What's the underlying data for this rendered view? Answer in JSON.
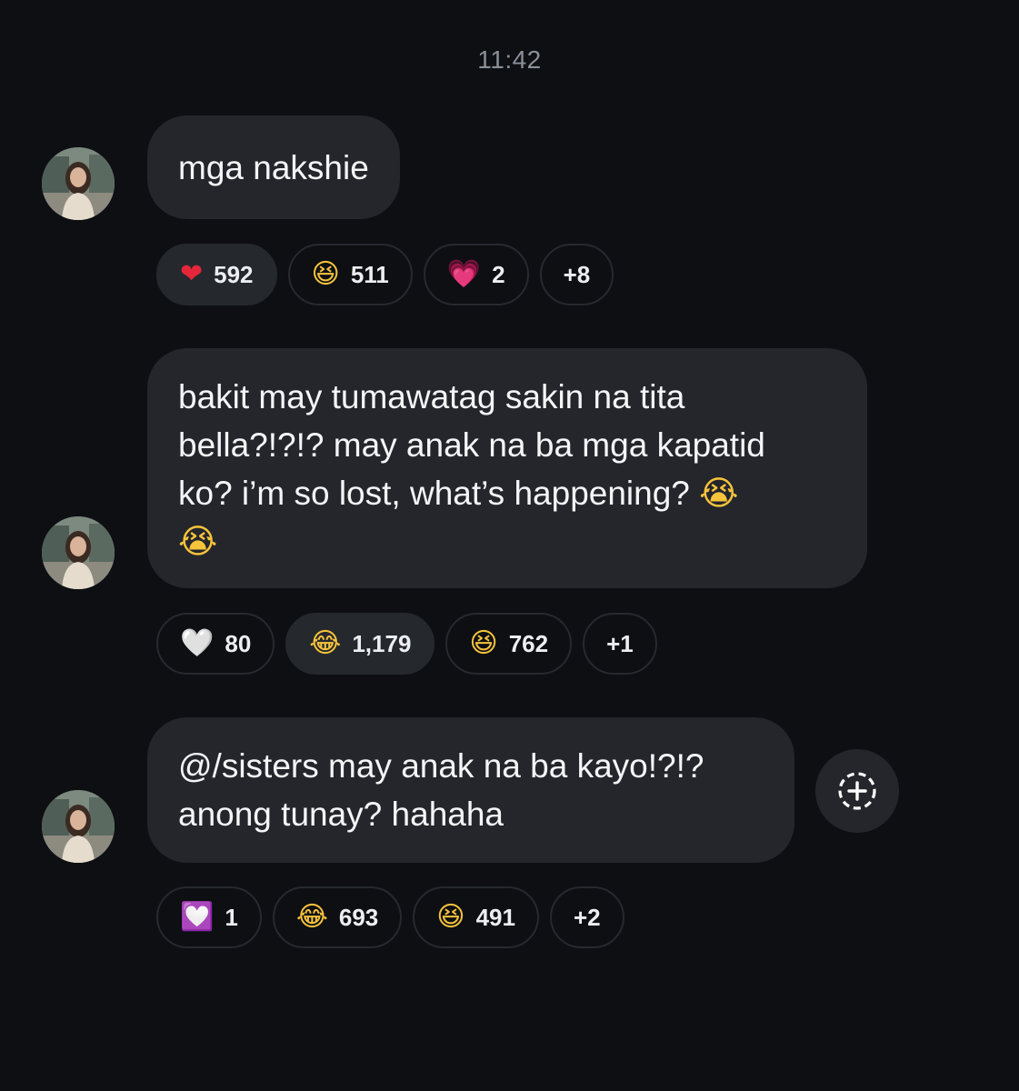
{
  "header": {
    "timestamp": "11:42"
  },
  "messages": [
    {
      "text": "mga nakshie",
      "reactions": [
        {
          "emoji": "❤",
          "icon": "red-heart-icon",
          "count": "592",
          "active": true
        },
        {
          "emoji": "😆",
          "icon": "grinning-squinting-face-icon",
          "count": "511",
          "active": false
        },
        {
          "emoji": "💗",
          "icon": "growing-heart-icon",
          "count": "2",
          "active": false
        },
        {
          "label": "+8",
          "active": false
        }
      ]
    },
    {
      "text": "bakit may tumawatag sakin na tita\nbella?!?!? may anak na ba mga kapatid\nko? i’m so lost, what’s happening? ",
      "emoji_end": "😭",
      "emoji_tail": "😭",
      "emoji_icon": "loudly-crying-face-icon",
      "reactions": [
        {
          "emoji": "🤍",
          "icon": "white-heart-icon",
          "count": "80",
          "active": false
        },
        {
          "emoji": "😂",
          "icon": "tears-of-joy-icon",
          "count": "1,179",
          "active": true
        },
        {
          "emoji": "😆",
          "icon": "grinning-squinting-face-icon",
          "count": "762",
          "active": false
        },
        {
          "label": "+1",
          "active": false
        }
      ]
    },
    {
      "text": "@/sisters may anak na ba kayo!?!?\nanong tunay? hahaha",
      "reactions": [
        {
          "emoji": "💟",
          "icon": "heart-decoration-icon",
          "count": "1",
          "active": false
        },
        {
          "emoji": "😂",
          "icon": "tears-of-joy-icon",
          "count": "693",
          "active": false
        },
        {
          "emoji": "😆",
          "icon": "grinning-squinting-face-icon",
          "count": "491",
          "active": false
        },
        {
          "label": "+2",
          "active": false
        }
      ]
    }
  ],
  "actions": {
    "add_reaction_icon": "add-reaction-icon"
  },
  "colors": {
    "background": "#0d0f13",
    "bubble": "#24262b",
    "chip_border": "#26292e",
    "timestamp": "#8a8f98",
    "text": "#f4f5f7"
  }
}
